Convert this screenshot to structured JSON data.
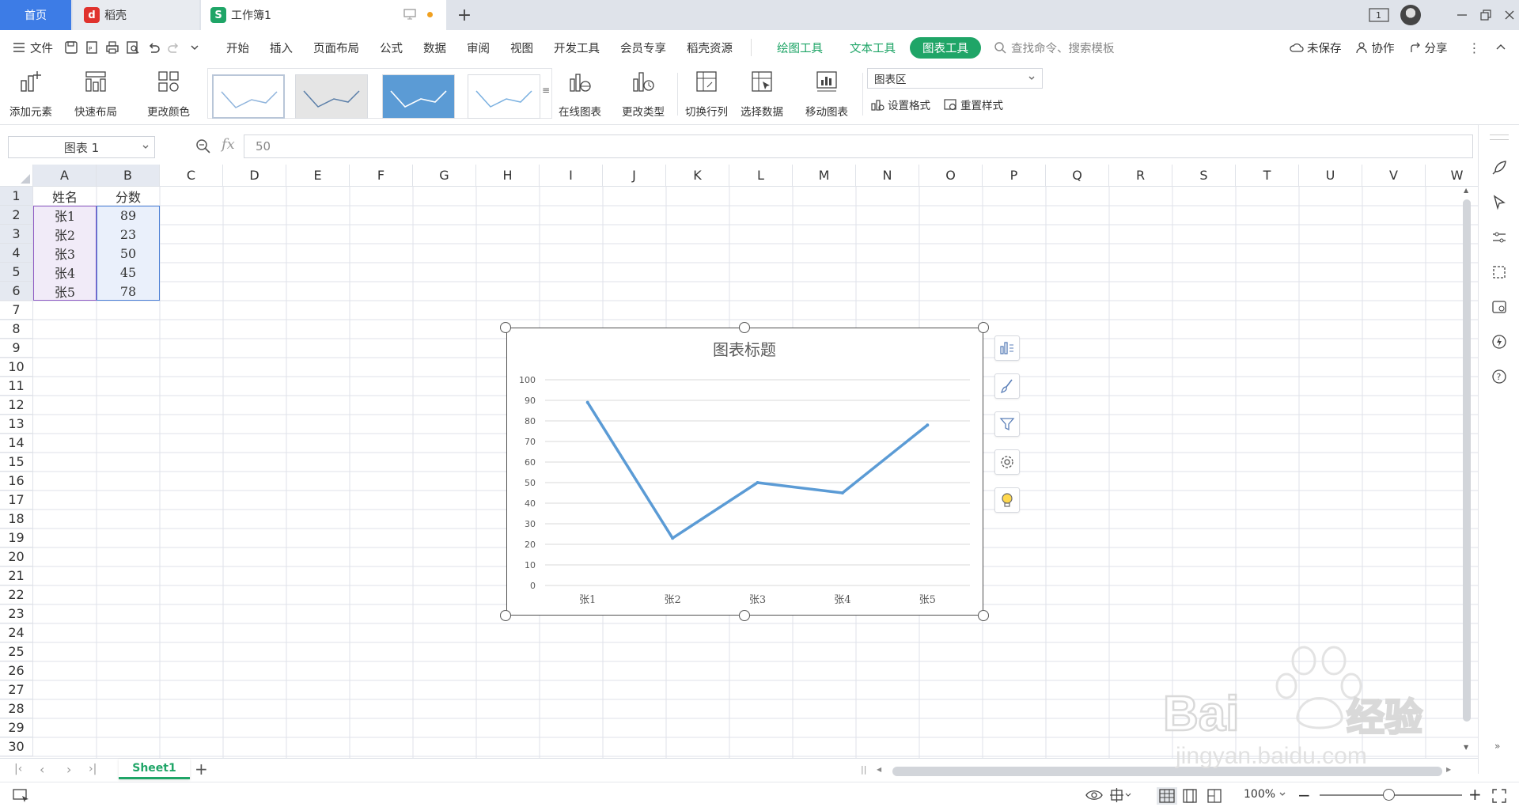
{
  "tabs": {
    "home": "首页",
    "docer": "稻壳",
    "workbook": "工作簿1"
  },
  "window": {
    "page_badge": "1"
  },
  "menu": {
    "file": "文件",
    "items": [
      "开始",
      "插入",
      "页面布局",
      "公式",
      "数据",
      "审阅",
      "视图",
      "开发工具",
      "会员专享",
      "稻壳资源"
    ],
    "context_tabs": [
      "绘图工具",
      "文本工具"
    ],
    "active_tab": "图表工具",
    "search_placeholder": "查找命令、搜索模板",
    "unsaved": "未保存",
    "collaborate": "协作",
    "share": "分享"
  },
  "ribbon": {
    "add_element": "添加元素",
    "quick_layout": "快速布局",
    "change_color": "更改颜色",
    "online_chart": "在线图表",
    "change_type": "更改类型",
    "switch_rowcol": "切换行列",
    "select_data": "选择数据",
    "move_chart": "移动图表",
    "chart_area": "图表区",
    "set_format": "设置格式",
    "reset_style": "重置样式"
  },
  "formula_bar": {
    "name_box": "图表 1",
    "fx": "fx",
    "value": "50"
  },
  "sheet": {
    "columns": [
      "A",
      "B",
      "C",
      "D",
      "E",
      "F",
      "G",
      "H",
      "I",
      "J",
      "K",
      "L",
      "M",
      "N",
      "O",
      "P",
      "Q",
      "R",
      "S",
      "T",
      "U",
      "V",
      "W"
    ],
    "rows": [
      "1",
      "2",
      "3",
      "4",
      "5",
      "6",
      "7",
      "8",
      "9",
      "10",
      "11",
      "12",
      "13",
      "14",
      "15",
      "16",
      "17",
      "18",
      "19",
      "20",
      "21",
      "22",
      "23",
      "24",
      "25",
      "26",
      "27",
      "28",
      "29",
      "30"
    ],
    "cells": [
      [
        "姓名",
        "分数"
      ],
      [
        "张1",
        "89"
      ],
      [
        "张2",
        "23"
      ],
      [
        "张3",
        "50"
      ],
      [
        "张4",
        "45"
      ],
      [
        "张5",
        "78"
      ]
    ],
    "tab": "Sheet1"
  },
  "chart_data": {
    "type": "line",
    "title": "图表标题",
    "categories": [
      "张1",
      "张2",
      "张3",
      "张4",
      "张5"
    ],
    "series": [
      {
        "values": [
          89,
          23,
          50,
          45,
          78
        ]
      }
    ],
    "ylim": [
      0,
      100
    ],
    "yticks": [
      "0",
      "10",
      "20",
      "30",
      "40",
      "50",
      "60",
      "70",
      "80",
      "90",
      "100"
    ],
    "line_color": "#5b9bd5",
    "grid": true
  },
  "status": {
    "zoom": "100%"
  },
  "colors": {
    "accent_green": "#1fa567",
    "home_tab_blue": "#3d7ce6",
    "selection_blue": "#4a7fd6",
    "selection_purple": "#8e5bc4"
  }
}
